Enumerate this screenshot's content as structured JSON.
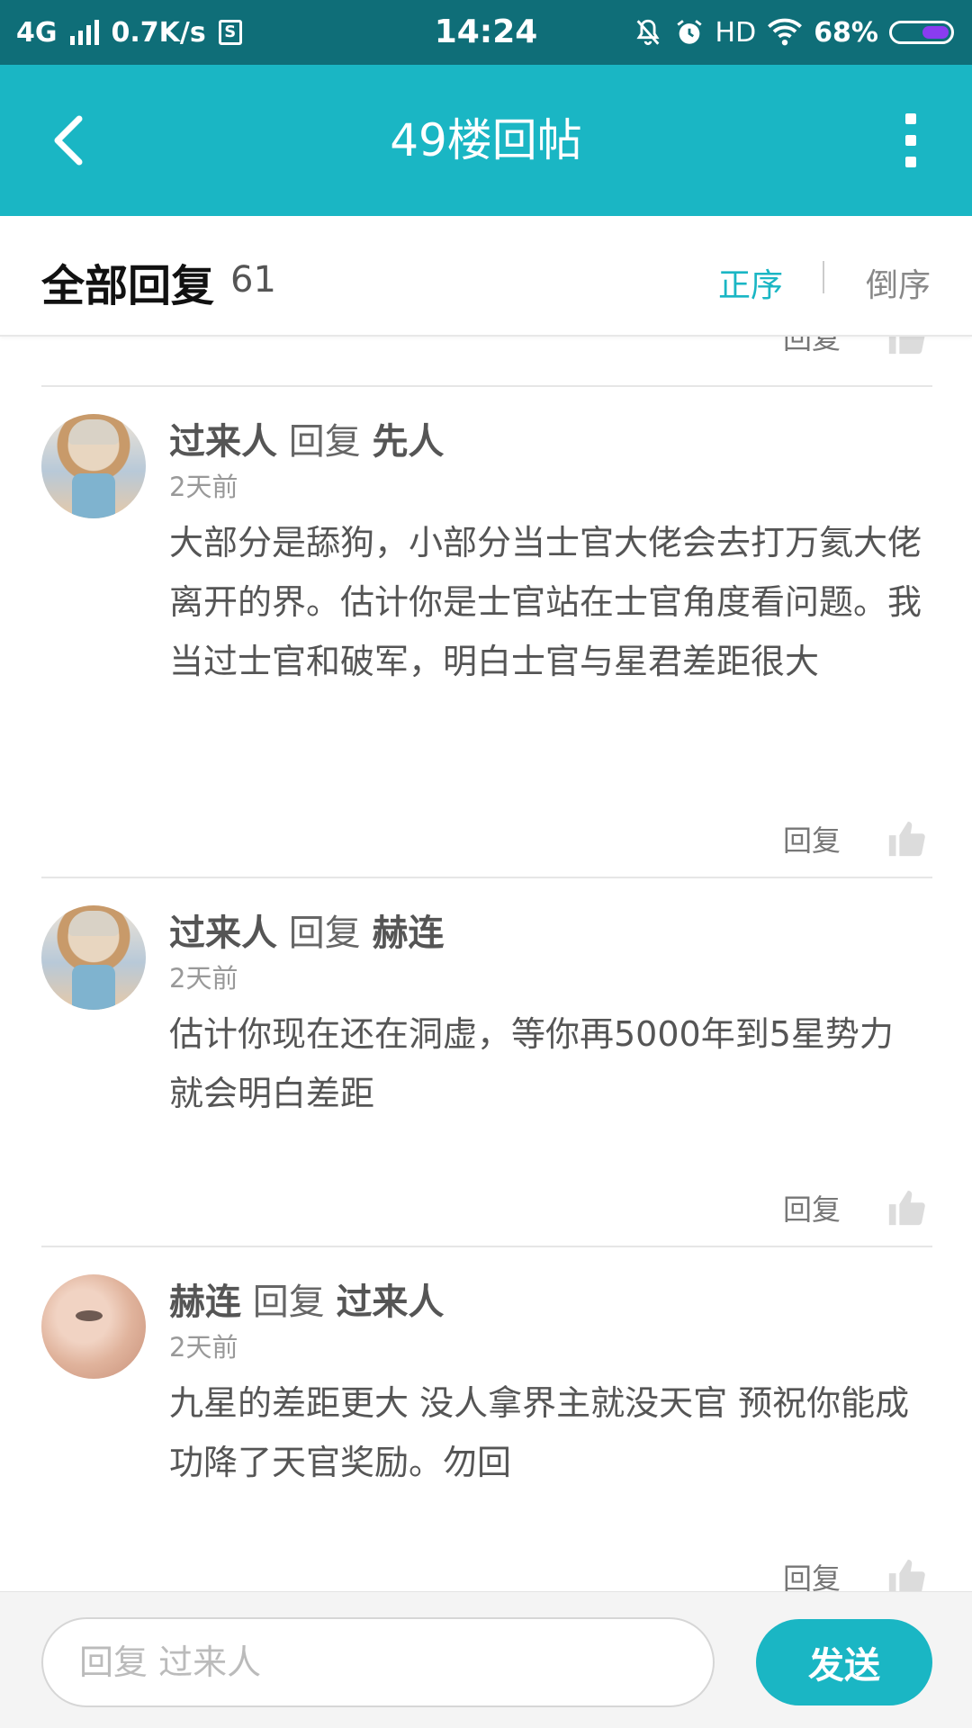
{
  "status_bar": {
    "network": "4G",
    "speed": "0.7K/s",
    "sim_icon_label": "S",
    "time": "14:24",
    "hd": "HD",
    "battery": "68%",
    "battery_level": 0.68
  },
  "header": {
    "title": "49楼回帖",
    "back_icon": "chevron-left-icon",
    "more_icon": "more-vertical-icon"
  },
  "section": {
    "title": "全部回复",
    "count": "61",
    "sort_asc": "正序",
    "sort_desc": "倒序"
  },
  "partial_row": {
    "reply_label": "回复"
  },
  "replies": [
    {
      "author": "过来人",
      "verb": " 回复 ",
      "target": "先人",
      "time": "2天前",
      "text": "大部分是舔狗，小部分当士官大佬会去打万氦大佬离开的界。估计你是士官站在士官角度看问题。我当过士官和破军，明白士官与星君差距很大",
      "reply_label": "回复",
      "avatar": "anime-avatar"
    },
    {
      "author": "过来人",
      "verb": " 回复 ",
      "target": "赫连",
      "time": "2天前",
      "text": "估计你现在还在洞虚，等你再5000年到5星势力就会明白差距",
      "reply_label": "回复",
      "avatar": "anime-avatar"
    },
    {
      "author": "赫连",
      "verb": " 回复 ",
      "target": "过来人",
      "time": "2天前",
      "text": "九星的差距更大 没人拿界主就没天官 预祝你能成功降了天官奖励。勿回",
      "reply_label": "回复",
      "avatar": "baby-avatar"
    }
  ],
  "bottom_bar": {
    "input_placeholder": "回复 过来人",
    "input_value": "",
    "send_label": "发送"
  },
  "colors": {
    "accent": "#1ab6c4",
    "status_bar": "#0f6e78",
    "battery_fill": "#8a3cf0"
  }
}
